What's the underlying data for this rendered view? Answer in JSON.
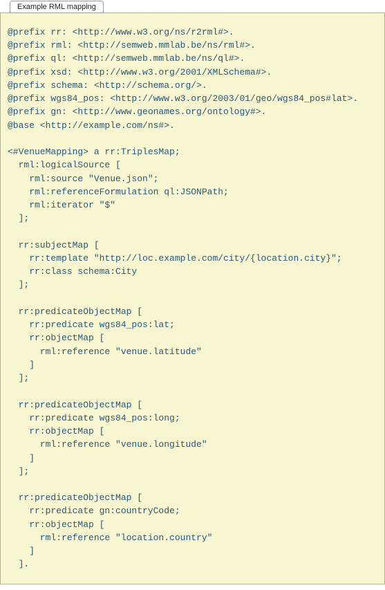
{
  "tab": {
    "label": "Example RML mapping"
  },
  "code": "@prefix rr: <http://www.w3.org/ns/r2rml#>.\n@prefix rml: <http://semweb.mmlab.be/ns/rml#>.\n@prefix ql: <http://semweb.mmlab.be/ns/ql#>.\n@prefix xsd: <http://www.w3.org/2001/XMLSchema#>.\n@prefix schema: <http://schema.org/>.\n@prefix wgs84_pos: <http://www.w3.org/2003/01/geo/wgs84_pos#lat>.\n@prefix gn: <http://www.geonames.org/ontology#>.\n@base <http://example.com/ns#>.\n\n<#VenueMapping> a rr:TriplesMap;\n  rml:logicalSource [\n    rml:source \"Venue.json\";\n    rml:referenceFormulation ql:JSONPath;\n    rml:iterator \"$\"\n  ];\n\n  rr:subjectMap [\n    rr:template \"http://loc.example.com/city/{location.city}\";\n    rr:class schema:City\n  ];\n\n  rr:predicateObjectMap [\n    rr:predicate wgs84_pos:lat;\n    rr:objectMap [\n      rml:reference \"venue.latitude\"\n    ]\n  ];\n\n  rr:predicateObjectMap [\n    rr:predicate wgs84_pos:long;\n    rr:objectMap [\n      rml:reference \"venue.longitude\"\n    ]\n  ];\n\n  rr:predicateObjectMap [\n    rr:predicate gn:countryCode;\n    rr:objectMap [\n      rml:reference \"location.country\"\n    ]\n  ]."
}
